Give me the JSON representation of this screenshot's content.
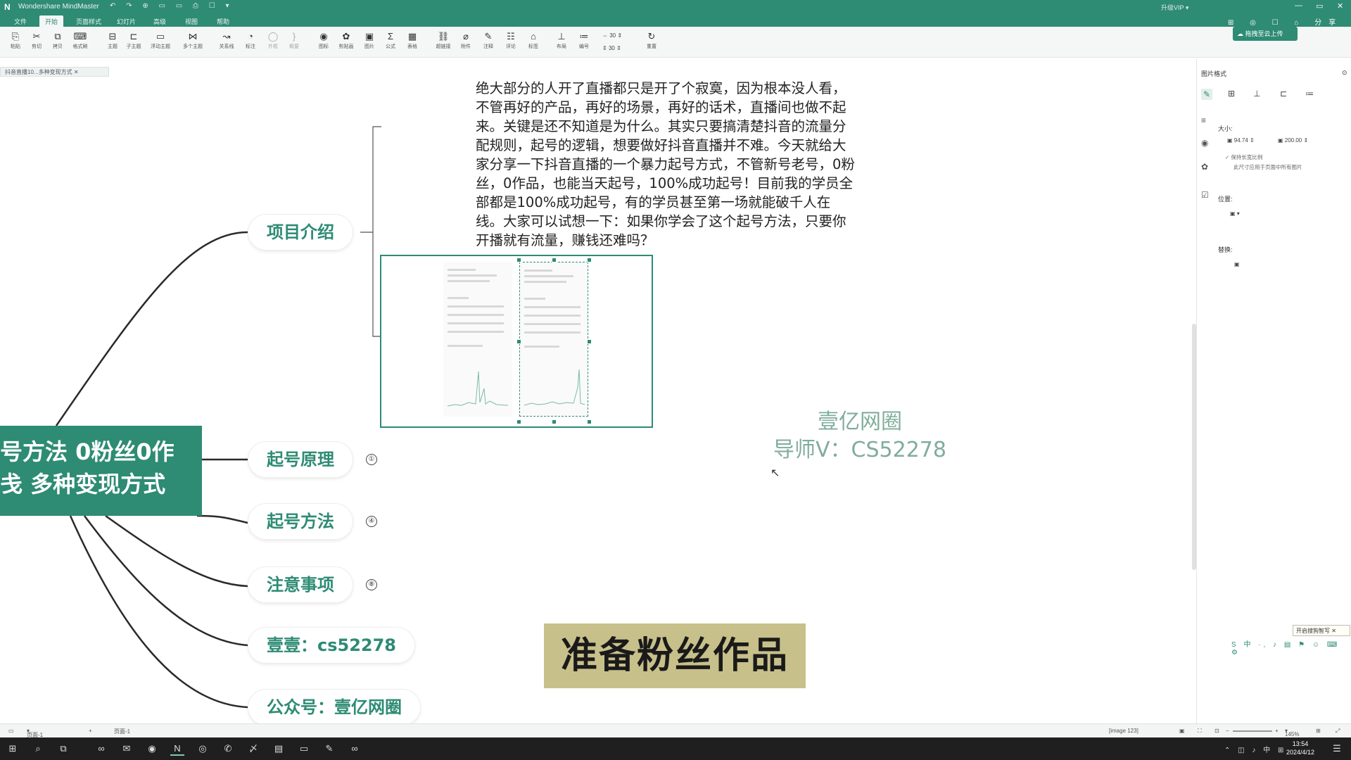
{
  "window": {
    "title": "Wondershare MindMaster",
    "quick_access": "↶ ↷ ⊕ ▭ ▭ ⎙ ☐ ▾",
    "vip": "升级VIP ▾",
    "min": "—",
    "max": "▭",
    "close": "✕"
  },
  "menu": [
    "文件",
    "开始",
    "页面样式",
    "幻灯片",
    "高级",
    "视图",
    "帮助"
  ],
  "menu_active": "开始",
  "menu_right_tools": "⊞ ◎ ☐ ⌂ 分享 ⬡ ?",
  "toolbar": {
    "items": [
      {
        "label": "粘贴",
        "icon": "⎘"
      },
      {
        "label": "剪切",
        "icon": "✂"
      },
      {
        "label": "拷贝",
        "icon": "⧉"
      },
      {
        "label": "格式刷",
        "icon": "⌨"
      },
      {
        "label": "主题",
        "icon": "⊟"
      },
      {
        "label": "子主题",
        "icon": "⊏"
      },
      {
        "label": "浮动主题",
        "icon": "▭"
      },
      {
        "label": "多个主题",
        "icon": "⋈"
      },
      {
        "label": "关系线",
        "icon": "↝"
      },
      {
        "label": "标注",
        "icon": "◔"
      },
      {
        "label": "外框",
        "icon": "◯"
      },
      {
        "label": "概要",
        "icon": "}"
      },
      {
        "label": "图标",
        "icon": "◉"
      },
      {
        "label": "剪贴画",
        "icon": "✿"
      },
      {
        "label": "图片",
        "icon": "▣"
      },
      {
        "label": "公式",
        "icon": "Σ"
      },
      {
        "label": "表格",
        "icon": "▦"
      },
      {
        "label": "超链接",
        "icon": "⛓"
      },
      {
        "label": "附件",
        "icon": "⌀"
      },
      {
        "label": "注释",
        "icon": "✎"
      },
      {
        "label": "评论",
        "icon": "☷"
      },
      {
        "label": "标签",
        "icon": "⌂"
      },
      {
        "label": "布局",
        "icon": "⊥"
      },
      {
        "label": "编号",
        "icon": "≔"
      },
      {
        "label": "重置",
        "icon": "↻"
      }
    ],
    "spacing_h": "30",
    "spacing_v": "30",
    "upload_badge": "拖拽至云上传"
  },
  "doc_tab": "抖音直播10...多种变现方式",
  "mindmap": {
    "central_line1": "号方法 0粉丝0作",
    "central_line2": "戋 多种变现方式",
    "topics": [
      {
        "label": "项目介绍",
        "badge": ""
      },
      {
        "label": "起号原理",
        "badge": "①"
      },
      {
        "label": "起号方法",
        "badge": "④"
      },
      {
        "label": "注意事项",
        "badge": "⑧"
      },
      {
        "label": "壹壹：cs52278",
        "badge": ""
      },
      {
        "label": "公众号：壹亿网圈",
        "badge": ""
      }
    ],
    "intro_text": "绝大部分的人开了直播都只是开了个寂寞，因为根本没人看，不管再好的产品，再好的场景，再好的话术，直播间也做不起来。关键是还不知道是为什么。其实只要搞清楚抖音的流量分配规则，起号的逻辑，想要做好抖音直播并不难。今天就给大家分享一下抖音直播的一个暴力起号方式，不管新号老号，0粉丝，0作品，也能当天起号，100%成功起号！目前我的学员全部都是100%成功起号，有的学员甚至第一场就能破千人在线。大家可以试想一下：如果你学会了这个起号方法，只要你开播就有流量，赚钱还难吗？"
  },
  "watermark": {
    "line1": "壹亿网圈",
    "line2": "导师V：CS52278"
  },
  "stamp": "准备粉丝作品",
  "format_panel": {
    "title": "图片格式",
    "size_label": "大小:",
    "width": "94.74",
    "height": "200.00",
    "keep_ratio": "保持长宽比例",
    "apply_all": "此尺寸应用于页面中所有图片",
    "position_label": "位置:",
    "replace_label": "替换:"
  },
  "ime": {
    "tip": "开启搜狗智写",
    "bar": "S 中 ·, ♪ ▤ ⚑ ☺ ⌨ ⚙"
  },
  "statusbar": {
    "page_selector": "页面-1",
    "page_tab": "页面-1",
    "image_info": "[image 123]",
    "zoom": "145%"
  },
  "taskbar": {
    "time": "13:54",
    "date": "2024/4/12",
    "tray": "⌃ ◫ ♪ 中 ⊞"
  },
  "colors": {
    "accent": "#2e8b74",
    "stamp_bg": "#c8c08a",
    "watermark": "#6a9f8a"
  }
}
